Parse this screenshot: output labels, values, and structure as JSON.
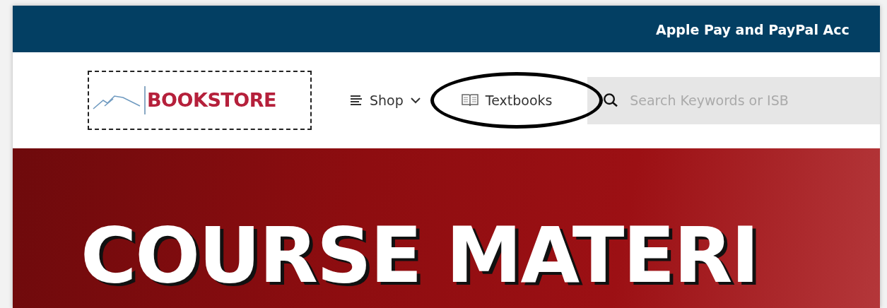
{
  "announcement": {
    "text": "Apple Pay and PayPal Acc"
  },
  "logo": {
    "text": "BOOKSTORE"
  },
  "nav": [
    {
      "kind": "menu",
      "label": "Shop",
      "circled": false
    },
    {
      "kind": "book",
      "label": "Textbooks",
      "circled": true
    }
  ],
  "search": {
    "placeholder": "Search Keywords or ISB"
  },
  "hero": {
    "title": "COURSE MATERI"
  }
}
